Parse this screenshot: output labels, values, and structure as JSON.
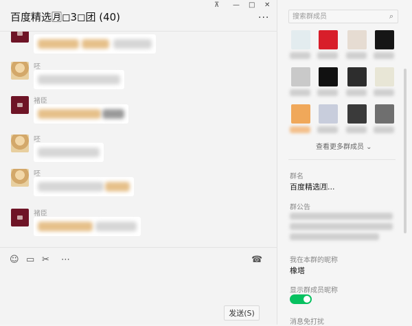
{
  "chat": {
    "title": "百度精选🈷◻3◻团 (40)",
    "more_icon": "···",
    "messages": [
      {
        "sender": "",
        "avatar": "dark"
      },
      {
        "sender": "呸",
        "avatar": "light"
      },
      {
        "sender": "褚臣",
        "avatar": "dark"
      },
      {
        "sender": "呸",
        "avatar": "light"
      },
      {
        "sender": "呸",
        "avatar": "light"
      },
      {
        "sender": "褚臣",
        "avatar": "dark"
      }
    ],
    "toolbar": {
      "emoji_icon": "☺",
      "folder_icon": "▭",
      "scissors_icon": "✂",
      "chat_bubble_icon": "⋯",
      "call_icon": "☎"
    },
    "send_label": "发送(S)"
  },
  "window": {
    "pin_icon": "⊼",
    "minimize_icon": "—",
    "maximize_icon": "□",
    "close_icon": "✕"
  },
  "panel": {
    "search_placeholder": "搜索群成员",
    "search_icon": "⌕",
    "see_more": "查看更多群成员 ⌄",
    "group_name_label": "群名",
    "group_name_value": "百度精选🈷...",
    "announcement_label": "群公告",
    "my_nickname_label": "我在本群的昵称",
    "my_nickname_value": "橡塔",
    "show_nickname_label": "显示群成员昵称",
    "show_nickname_on": true,
    "mute_label": "消息免打扰"
  }
}
